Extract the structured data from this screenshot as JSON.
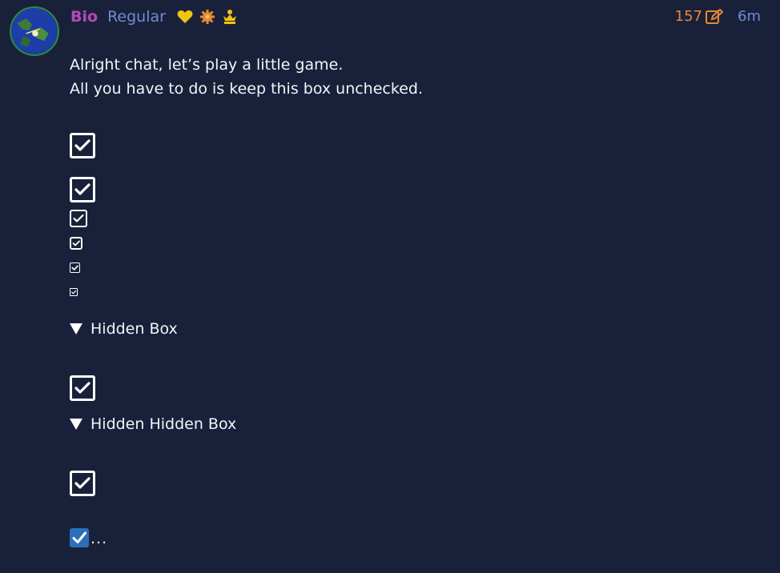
{
  "author": {
    "username": "Bio",
    "rank": "Regular",
    "badges": [
      "heart-badge",
      "gear-badge",
      "crown-badge"
    ],
    "avatar": "earth-avatar"
  },
  "meta": {
    "edit_count": "157",
    "time_ago": "6m"
  },
  "post": {
    "line1": "Alright chat, let’s play a little game.",
    "line2": "All you have to do is keep this box unchecked.",
    "hidden_box_label": "Hidden Box",
    "hidden_hidden_box_label": "Hidden Hidden Box",
    "checkbox_states": [
      true,
      true,
      true,
      true,
      true,
      true,
      true,
      true,
      true
    ],
    "trailing_text": "..."
  },
  "colors": {
    "background": "#19213a",
    "username": "#b14bb8",
    "rank": "#6f8bd0",
    "edit_count": "#e88930",
    "time": "#6f8bd0",
    "checkbox_native": "#2c6fb8"
  }
}
